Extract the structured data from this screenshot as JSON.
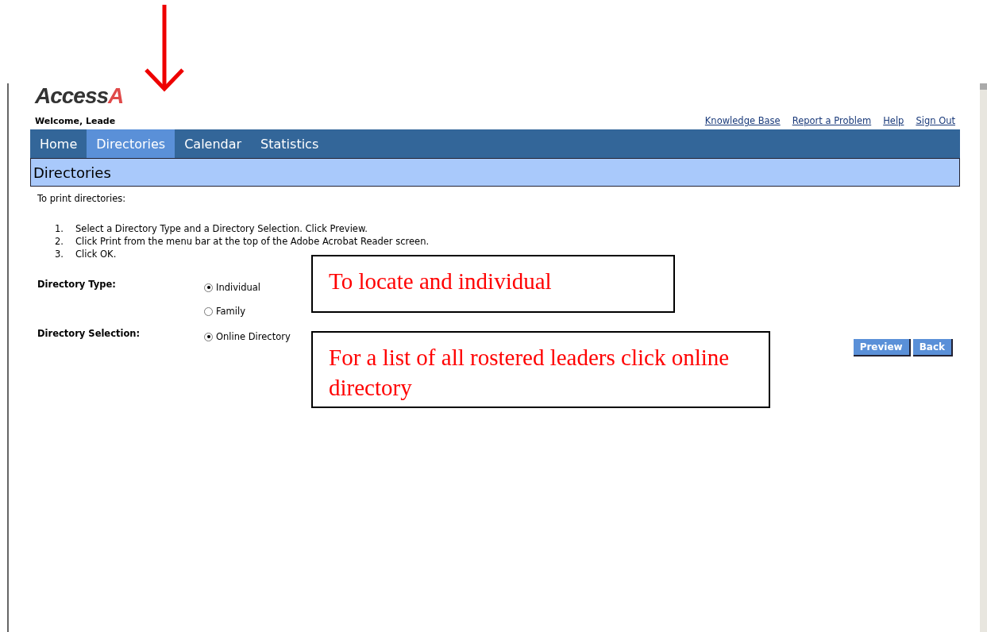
{
  "logo": {
    "text": "Access",
    "cut": "A"
  },
  "welcome": "Welcome, Leade",
  "top_links": [
    "Knowledge Base",
    "Report a Problem",
    "Help",
    "Sign Out"
  ],
  "nav": [
    {
      "label": "Home",
      "selected": false
    },
    {
      "label": "Directories",
      "selected": true
    },
    {
      "label": "Calendar",
      "selected": false
    },
    {
      "label": "Statistics",
      "selected": false
    }
  ],
  "section_title": "Directories",
  "intro": "To print directories:",
  "steps": [
    {
      "number": "1.",
      "text": "Select a Directory Type and a Directory Selection. Click Preview."
    },
    {
      "number": "2.",
      "text": "Click Print from the menu bar at the top of the Adobe Acrobat Reader screen."
    },
    {
      "number": "3.",
      "text": "Click OK."
    }
  ],
  "fields": [
    {
      "label": "Directory Type:",
      "options": [
        {
          "label": "Individual",
          "selected": true
        },
        {
          "label": "Family",
          "selected": false
        }
      ]
    },
    {
      "label": "Directory Selection:",
      "options": [
        {
          "label": "Online Directory",
          "selected": true
        }
      ]
    }
  ],
  "buttons": [
    "Preview",
    "Back"
  ],
  "annotations": [
    {
      "text": "To locate and individual"
    },
    {
      "text": "For a list of all rostered leaders click online directory"
    }
  ]
}
